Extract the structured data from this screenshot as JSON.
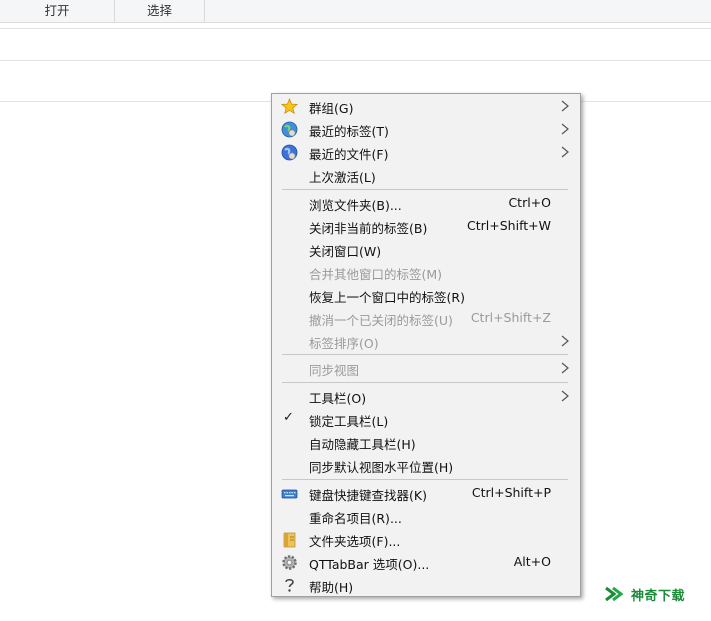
{
  "ribbon": {
    "tab_open": "打开",
    "tab_select": "选择"
  },
  "menu": {
    "group": "群组(G)",
    "recent_tabs": "最近的标签(T)",
    "recent_files": "最近的文件(F)",
    "last_activated": "上次激活(L)",
    "browse_folder": "浏览文件夹(B)...",
    "browse_folder_sc": "Ctrl+O",
    "close_others": "关闭非当前的标签(B)",
    "close_others_sc": "Ctrl+Shift+W",
    "close_window": "关闭窗口(W)",
    "merge_windows": "合并其他窗口的标签(M)",
    "restore_window_tabs": "恢复上一个窗口中的标签(R)",
    "undo_close": "撤消一个已关闭的标签(U)",
    "undo_close_sc": "Ctrl+Shift+Z",
    "sort_tabs": "标签排序(O)",
    "sync_view": "同步视图",
    "toolbars": "工具栏(O)",
    "lock_toolbars": "锁定工具栏(L)",
    "auto_hide": "自动隐藏工具栏(H)",
    "sync_default_hscroll": "同步默认视图水平位置(H)",
    "keyboard_finder": "键盘快捷键查找器(K)",
    "keyboard_finder_sc": "Ctrl+Shift+P",
    "rename_items": "重命名项目(R)...",
    "folder_options": "文件夹选项(F)...",
    "qttabbar_options": "QTTabBar 选项(O)...",
    "qttabbar_options_sc": "Alt+O",
    "help": "帮助(H)",
    "check_mark": "✓"
  },
  "watermark": {
    "text": "神奇下载"
  },
  "colors": {
    "menu_bg": "#f2f2f2",
    "disabled_text": "#9a9a9a",
    "separator": "#c8c8c8",
    "watermark_green": "#1d8a3a"
  }
}
